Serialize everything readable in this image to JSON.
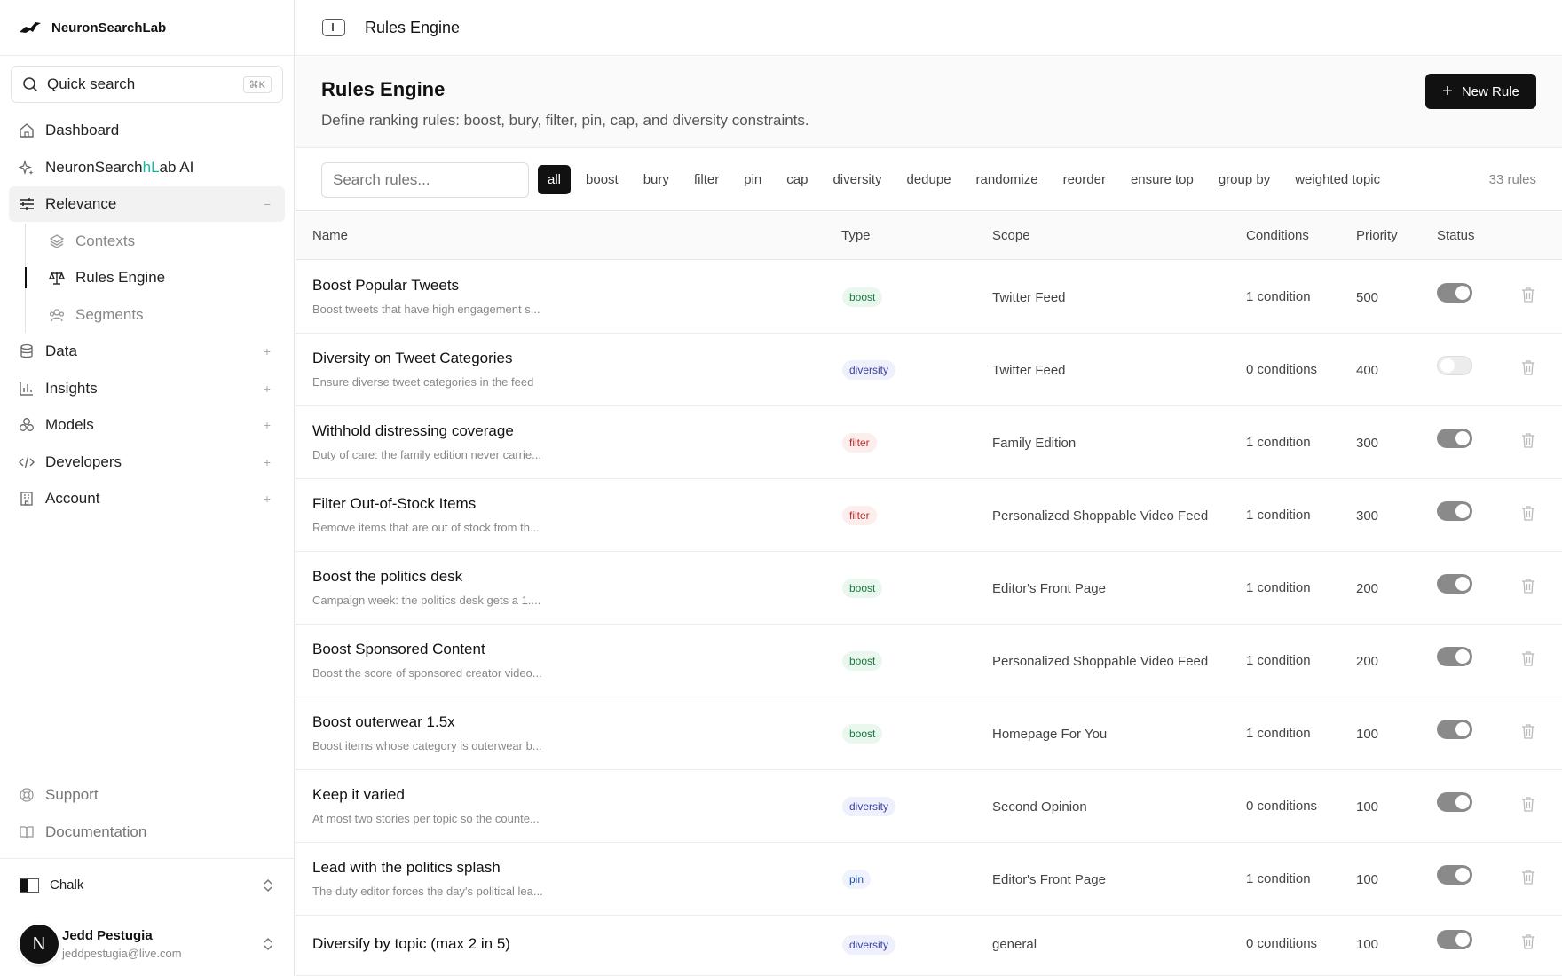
{
  "brand": {
    "name": "NeuronSearchLab"
  },
  "search": {
    "label": "Quick search",
    "shortcut": "⌘K"
  },
  "nav": {
    "dashboard": "Dashboard",
    "ai_prefix": "NeuronSearch",
    "ai_highlight": "hL",
    "ai_suffix": "ab AI",
    "relevance": "Relevance",
    "contexts": "Contexts",
    "rules_engine": "Rules Engine",
    "segments": "Segments",
    "data": "Data",
    "insights": "Insights",
    "models": "Models",
    "developers": "Developers",
    "account": "Account",
    "support": "Support",
    "documentation": "Documentation"
  },
  "org": {
    "name": "Chalk"
  },
  "user": {
    "initial": "N",
    "name": "Jedd Pestugia",
    "email": "jeddpestugia@live.com"
  },
  "topbar": {
    "title": "Rules Engine"
  },
  "header": {
    "title": "Rules Engine",
    "subtitle": "Define ranking rules: boost, bury, filter, pin, cap, and diversity constraints.",
    "new_button": "New Rule"
  },
  "filters": {
    "placeholder": "Search rules...",
    "chips": [
      "all",
      "boost",
      "bury",
      "filter",
      "pin",
      "cap",
      "diversity",
      "dedupe",
      "randomize",
      "reorder",
      "ensure top",
      "group by",
      "weighted topic"
    ],
    "count": "33 rules"
  },
  "table": {
    "columns": {
      "name": "Name",
      "type": "Type",
      "scope": "Scope",
      "conditions": "Conditions",
      "priority": "Priority",
      "status": "Status"
    },
    "rows": [
      {
        "name": "Boost Popular Tweets",
        "desc": "Boost tweets that have high engagement s...",
        "type": "boost",
        "scope": "Twitter Feed",
        "conditions": "1 condition",
        "priority": "500",
        "enabled": true
      },
      {
        "name": "Diversity on Tweet Categories",
        "desc": "Ensure diverse tweet categories in the feed",
        "type": "diversity",
        "scope": "Twitter Feed",
        "conditions": "0 conditions",
        "priority": "400",
        "enabled": false
      },
      {
        "name": "Withhold distressing coverage",
        "desc": "Duty of care: the family edition never carrie...",
        "type": "filter",
        "scope": "Family Edition",
        "conditions": "1 condition",
        "priority": "300",
        "enabled": true
      },
      {
        "name": "Filter Out-of-Stock Items",
        "desc": "Remove items that are out of stock from th...",
        "type": "filter",
        "scope": "Personalized Shoppable Video Feed",
        "conditions": "1 condition",
        "priority": "300",
        "enabled": true
      },
      {
        "name": "Boost the politics desk",
        "desc": "Campaign week: the politics desk gets a 1....",
        "type": "boost",
        "scope": "Editor's Front Page",
        "conditions": "1 condition",
        "priority": "200",
        "enabled": true
      },
      {
        "name": "Boost Sponsored Content",
        "desc": "Boost the score of sponsored creator video...",
        "type": "boost",
        "scope": "Personalized Shoppable Video Feed",
        "conditions": "1 condition",
        "priority": "200",
        "enabled": true
      },
      {
        "name": "Boost outerwear 1.5x",
        "desc": "Boost items whose category is outerwear b...",
        "type": "boost",
        "scope": "Homepage For You",
        "conditions": "1 condition",
        "priority": "100",
        "enabled": true
      },
      {
        "name": "Keep it varied",
        "desc": "At most two stories per topic so the counte...",
        "type": "diversity",
        "scope": "Second Opinion",
        "conditions": "0 conditions",
        "priority": "100",
        "enabled": true
      },
      {
        "name": "Lead with the politics splash",
        "desc": "The duty editor forces the day's political lea...",
        "type": "pin",
        "scope": "Editor's Front Page",
        "conditions": "1 condition",
        "priority": "100",
        "enabled": true
      },
      {
        "name": "Diversify by topic (max 2 in 5)",
        "desc": "",
        "type": "diversity",
        "scope": "general",
        "conditions": "0 conditions",
        "priority": "100",
        "enabled": true
      }
    ]
  },
  "icons": {
    "search": "search-icon",
    "dashboard": "home-icon",
    "ai": "sparkles-icon",
    "relevance": "sliders-icon",
    "contexts": "layers-icon",
    "rules": "scale-icon",
    "segments": "users-icon",
    "data": "database-icon",
    "insights": "bar-chart-icon",
    "models": "cubes-icon",
    "developers": "code-icon",
    "account": "building-icon",
    "support": "lifebuoy-icon",
    "docs": "book-icon",
    "trash": "trash-icon"
  }
}
